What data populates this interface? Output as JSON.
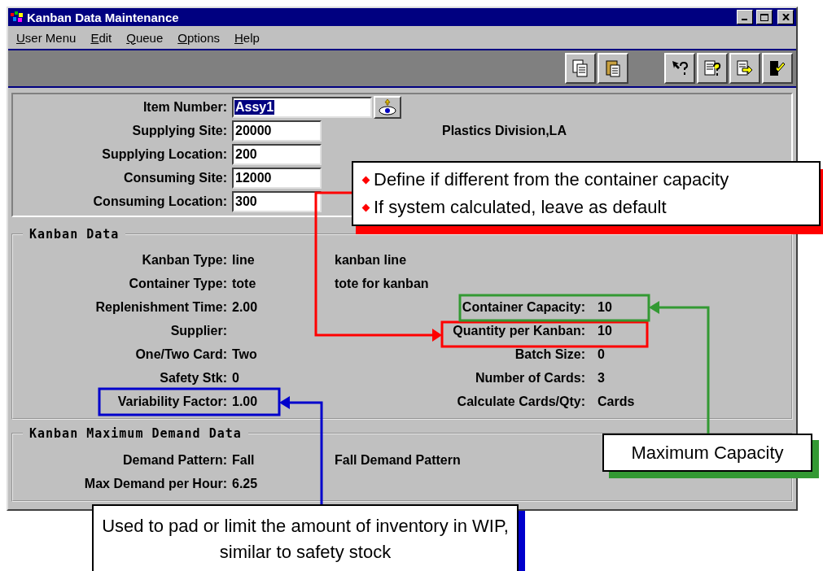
{
  "window": {
    "title": "Kanban Data Maintenance"
  },
  "menu": [
    "User Menu",
    "Edit",
    "Queue",
    "Options",
    "Help"
  ],
  "header_fields": [
    {
      "label": "Item Number:",
      "value": "Assy1",
      "selected": true,
      "kind": "lookup"
    },
    {
      "label": "Supplying Site:",
      "value": "20000",
      "selected": false,
      "kind": "plain",
      "description": "Plastics Division,LA"
    },
    {
      "label": "Supplying Location:",
      "value": "200",
      "selected": false,
      "kind": "plain"
    },
    {
      "label": "Consuming Site:",
      "value": "12000",
      "selected": false,
      "kind": "plain"
    },
    {
      "label": "Consuming Location:",
      "value": "300",
      "selected": false,
      "kind": "plain"
    }
  ],
  "kanban_data": {
    "title": "Kanban Data",
    "left_fields": [
      {
        "label": "Kanban Type:",
        "value": "line",
        "description": "kanban line"
      },
      {
        "label": "Container Type:",
        "value": "tote",
        "description": "tote for kanban"
      },
      {
        "label": "Replenishment Time:",
        "value": "2.00"
      },
      {
        "label": "Supplier:"
      },
      {
        "label": "One/Two Card:",
        "value": "Two"
      },
      {
        "label": "Safety Stk:",
        "value": "0"
      },
      {
        "label": "Variability Factor:",
        "value": "1.00"
      }
    ],
    "right_fields": [
      {
        "label": "Container Capacity:",
        "value": "10"
      },
      {
        "label": "Quantity per Kanban:",
        "value": "10"
      },
      {
        "label": "Batch Size:",
        "value": "0"
      },
      {
        "label": "Number of Cards:",
        "value": "3"
      },
      {
        "label": "Calculate Cards/Qty:",
        "value": "Cards"
      }
    ]
  },
  "max_demand": {
    "title": "Kanban Maximum Demand Data",
    "fields": [
      {
        "label": "Demand Pattern:",
        "value": "Fall",
        "description": "Fall Demand Pattern"
      },
      {
        "label": "Max Demand per Hour:",
        "value": "6.25"
      }
    ]
  },
  "annotations": [
    {
      "kind": "bullets",
      "color": "#ff0000",
      "items": [
        "Define if different from the container capacity",
        "If system calculated, leave as default"
      ]
    },
    {
      "kind": "note",
      "color": "#339933",
      "text": "Maximum Capacity"
    },
    {
      "kind": "note",
      "color": "#0000cc",
      "text": "Used to pad or limit the amount of inventory in WIP, similar to safety stock"
    }
  ]
}
